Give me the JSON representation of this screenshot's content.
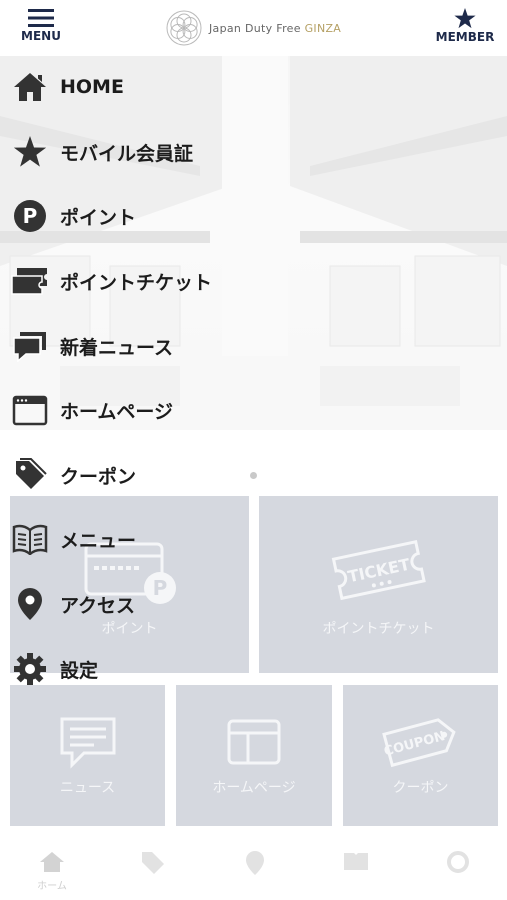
{
  "header": {
    "menu_label": "MENU",
    "member_label": "MEMBER",
    "logo_prefix": "Japan Duty Free ",
    "logo_suffix": "GINZA"
  },
  "menu": {
    "items": [
      {
        "label": "HOME",
        "icon": "home-icon"
      },
      {
        "label": "モバイル会員証",
        "icon": "star-icon"
      },
      {
        "label": "ポイント",
        "icon": "point-icon"
      },
      {
        "label": "ポイントチケット",
        "icon": "ticket-icon"
      },
      {
        "label": "新着ニュース",
        "icon": "news-icon"
      },
      {
        "label": "ホームページ",
        "icon": "browser-icon"
      },
      {
        "label": "クーポン",
        "icon": "tag-icon"
      },
      {
        "label": "メニュー",
        "icon": "book-icon"
      },
      {
        "label": "アクセス",
        "icon": "location-pin-icon"
      },
      {
        "label": "設定",
        "icon": "gear-icon"
      }
    ]
  },
  "tiles": [
    {
      "label": "ポイント",
      "icon": "point-card-icon"
    },
    {
      "label": "ポイントチケット",
      "icon": "ticket-icon",
      "icon_text": "TICKET"
    },
    {
      "label": "ニュース",
      "icon": "news-icon"
    },
    {
      "label": "ホームページ",
      "icon": "browser-icon"
    },
    {
      "label": "クーポン",
      "icon": "coupon-icon",
      "icon_text": "COUPON"
    }
  ],
  "bottom_nav": [
    {
      "label": "ホーム",
      "icon": "home-icon"
    },
    {
      "label": "",
      "icon": "tag-icon"
    },
    {
      "label": "",
      "icon": "location-pin-icon"
    },
    {
      "label": "",
      "icon": "book-icon"
    },
    {
      "label": "",
      "icon": "gear-icon"
    }
  ],
  "colors": {
    "navy": "#1e2a4a",
    "tile_bg": "#d5d8df",
    "logo_gold": "#b5a064"
  }
}
